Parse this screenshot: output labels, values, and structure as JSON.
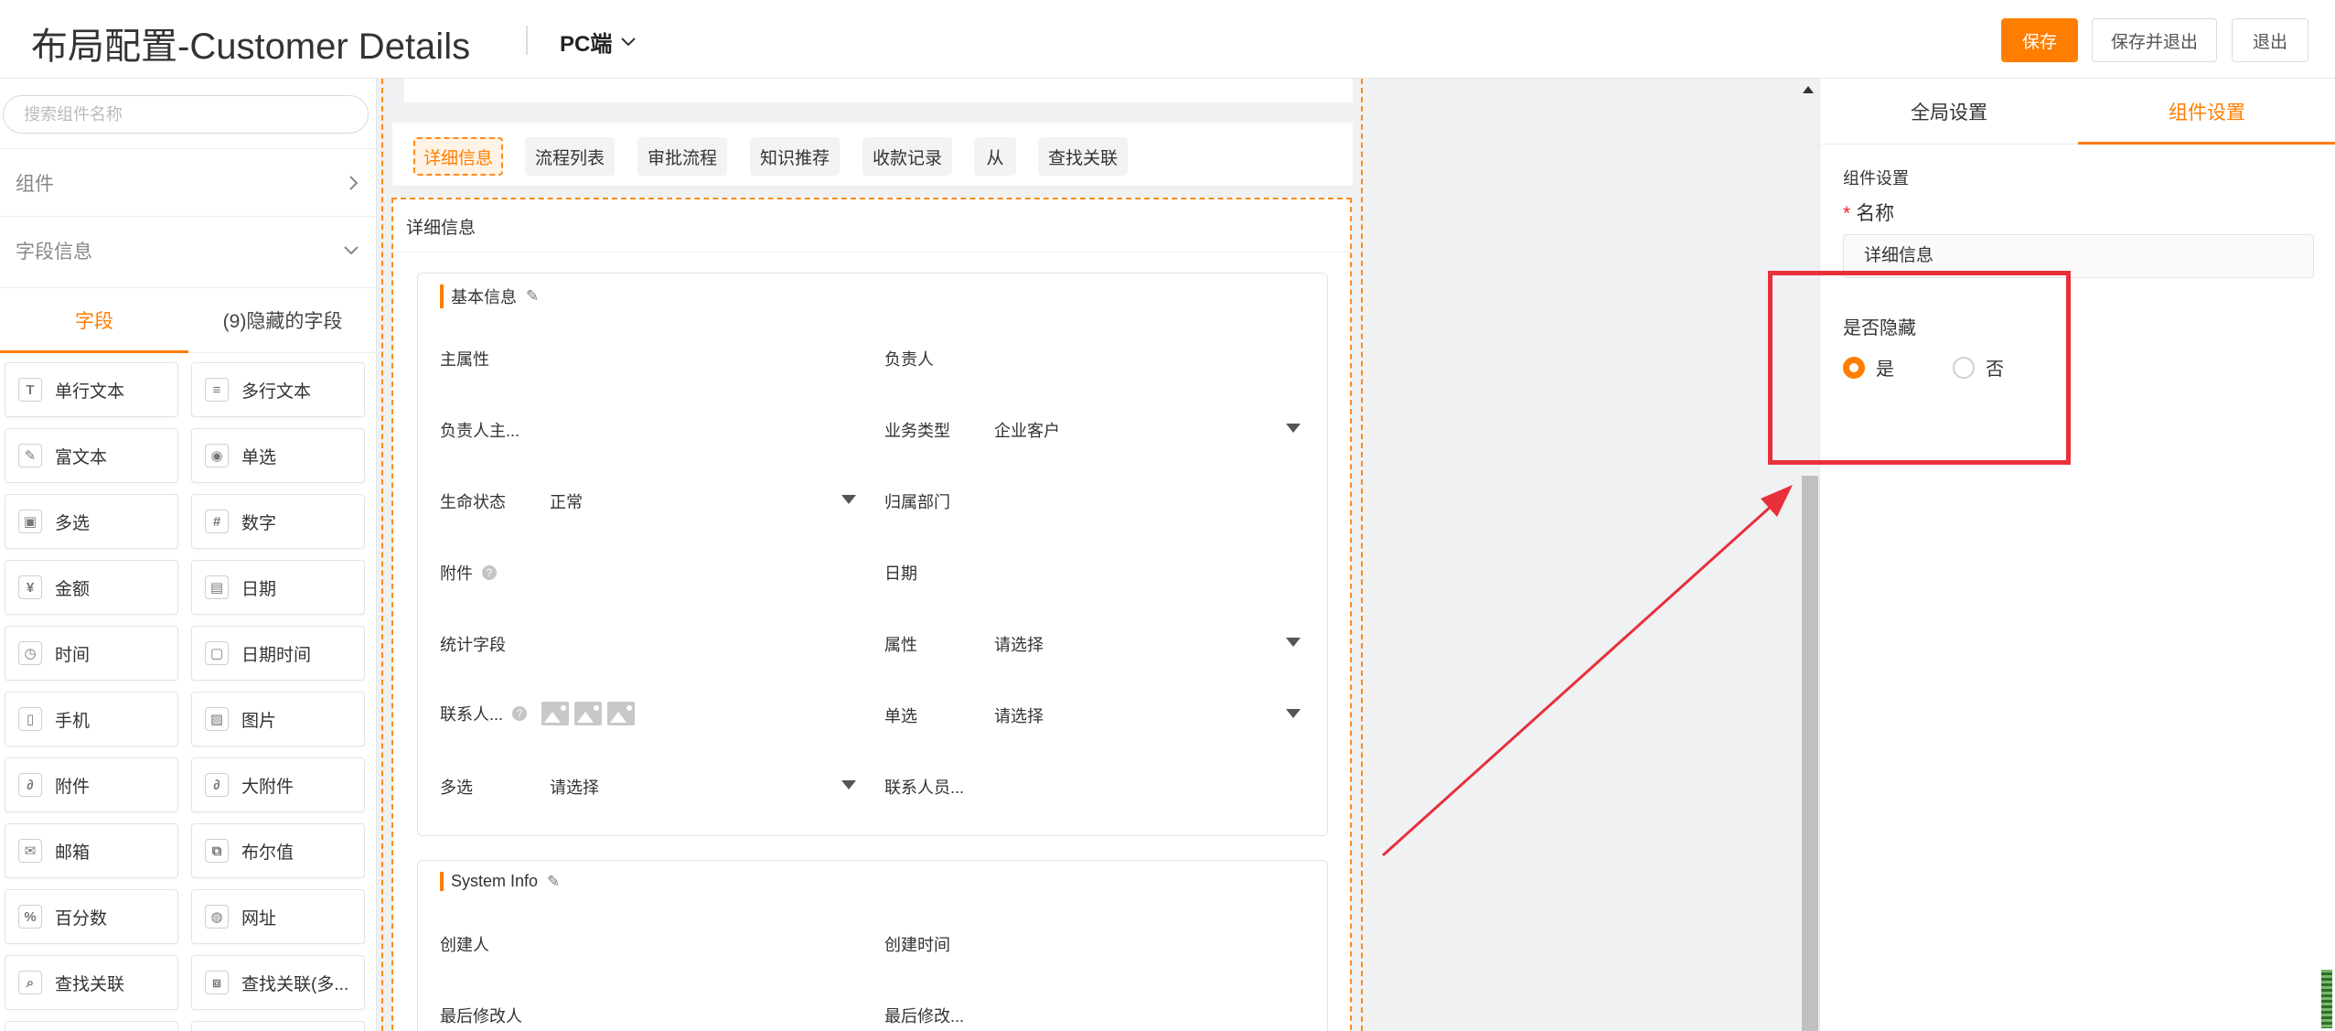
{
  "header": {
    "title": "布局配置-Customer Details",
    "platform": "PC端",
    "save_label": "保存",
    "save_exit_label": "保存并退出",
    "exit_label": "退出"
  },
  "left_panel": {
    "search_placeholder": "搜索组件名称",
    "components_label": "组件",
    "field_info_label": "字段信息",
    "tabs": [
      "字段",
      "(9)隐藏的字段"
    ],
    "fields": [
      {
        "label": "单行文本",
        "icon": "text-icon"
      },
      {
        "label": "多行文本",
        "icon": "multiline-icon"
      },
      {
        "label": "富文本",
        "icon": "richtext-icon"
      },
      {
        "label": "单选",
        "icon": "radio-icon"
      },
      {
        "label": "多选",
        "icon": "checkbox-icon"
      },
      {
        "label": "数字",
        "icon": "hash-icon"
      },
      {
        "label": "金额",
        "icon": "currency-icon"
      },
      {
        "label": "日期",
        "icon": "calendar-icon"
      },
      {
        "label": "时间",
        "icon": "clock-icon"
      },
      {
        "label": "日期时间",
        "icon": "datetime-icon"
      },
      {
        "label": "手机",
        "icon": "phone-icon"
      },
      {
        "label": "图片",
        "icon": "image-icon"
      },
      {
        "label": "附件",
        "icon": "attachment-icon"
      },
      {
        "label": "大附件",
        "icon": "large-attachment-icon"
      },
      {
        "label": "邮箱",
        "icon": "email-icon"
      },
      {
        "label": "布尔值",
        "icon": "boolean-icon"
      },
      {
        "label": "百分数",
        "icon": "percent-icon"
      },
      {
        "label": "网址",
        "icon": "globe-icon"
      },
      {
        "label": "查找关联",
        "icon": "lookup-icon"
      },
      {
        "label": "查找关联(多...",
        "icon": "lookup-multi-icon"
      }
    ]
  },
  "canvas": {
    "tabs": [
      "详细信息",
      "流程列表",
      "审批流程",
      "知识推荐",
      "收款记录",
      "从",
      "查找关联"
    ],
    "detail_title": "详细信息",
    "basic_group": {
      "title": "基本信息",
      "fields": {
        "primary": "主属性",
        "owner": "负责人",
        "owner_main": "负责人主...",
        "biz_type": "业务类型",
        "biz_type_value": "企业客户",
        "life_status": "生命状态",
        "life_status_value": "正常",
        "dept": "归属部门",
        "attachment": "附件",
        "date": "日期",
        "stats": "统计字段",
        "attribute": "属性",
        "attribute_value": "请选择",
        "contact": "联系人...",
        "single": "单选",
        "single_value": "请选择",
        "multi": "多选",
        "multi_value": "请选择",
        "contact_member": "联系人员..."
      }
    },
    "system_group": {
      "title": "System Info",
      "fields": {
        "creator": "创建人",
        "created_time": "创建时间",
        "last_modifier": "最后修改人",
        "last_modified": "最后修改..."
      }
    }
  },
  "right_panel": {
    "tabs": [
      "全局设置",
      "组件设置"
    ],
    "section_title": "组件设置",
    "name_label": "名称",
    "name_required": "*",
    "name_value": "详细信息",
    "hidden_label": "是否隐藏",
    "yes_label": "是",
    "no_label": "否",
    "hidden_selected": "是"
  },
  "colors": {
    "accent": "#ff7e00",
    "annotation_red": "#e8303a"
  }
}
